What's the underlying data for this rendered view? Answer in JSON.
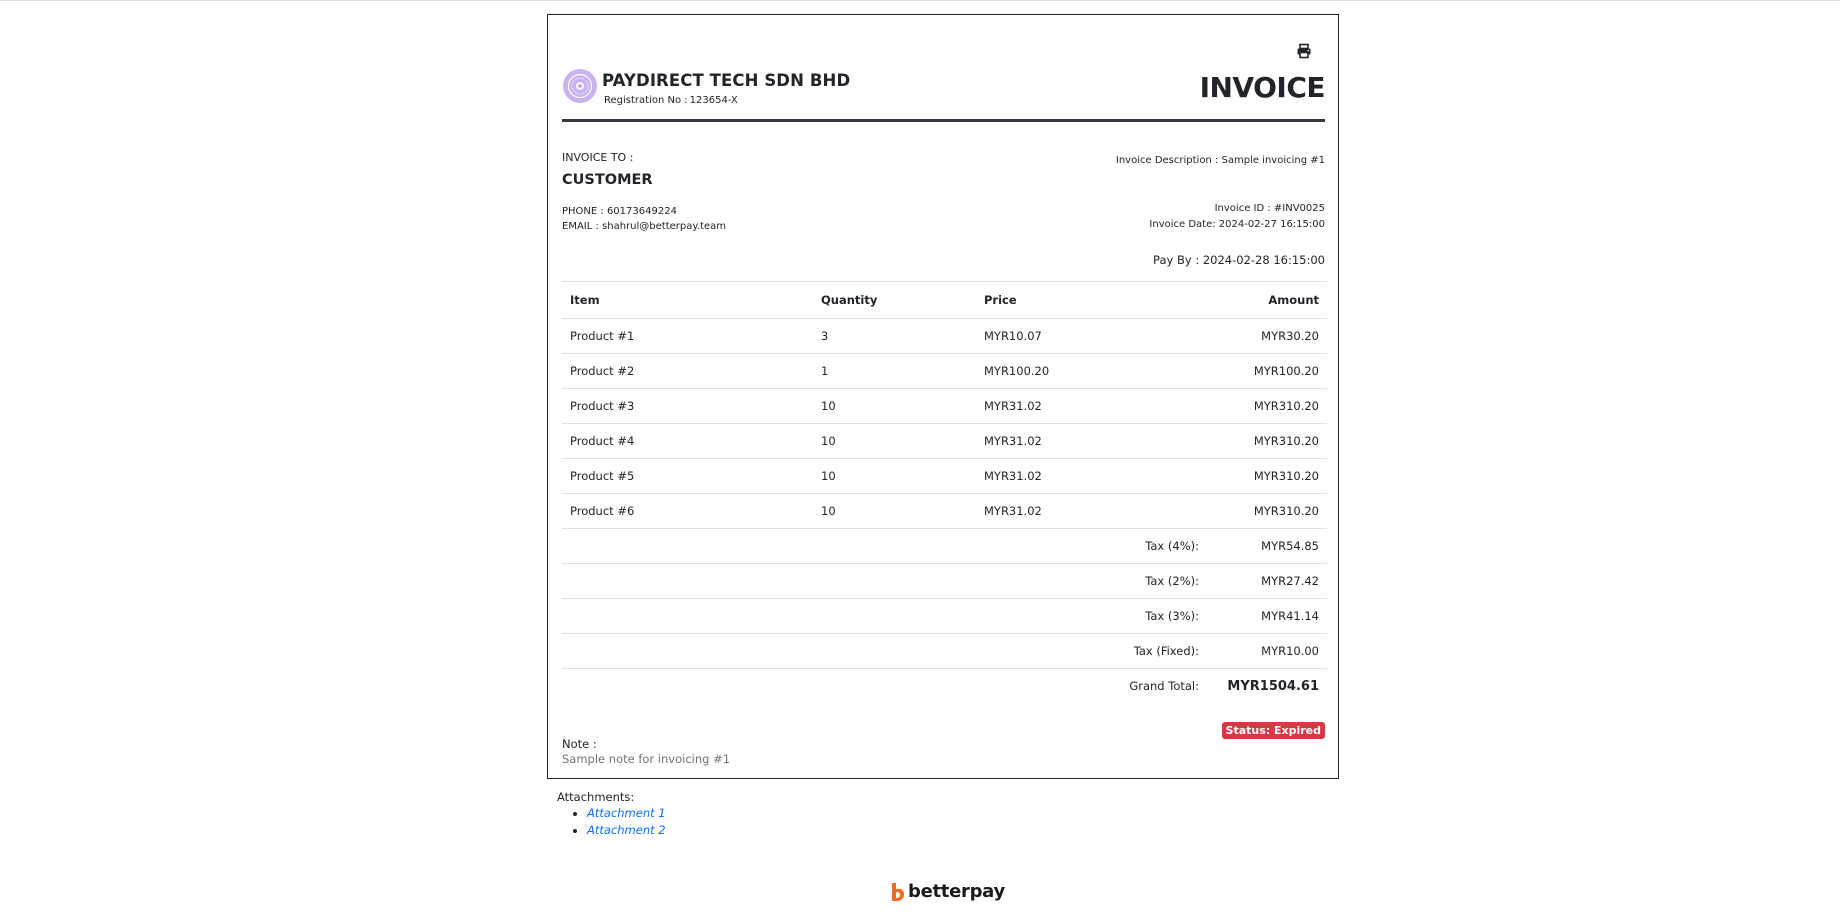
{
  "company": {
    "name": "PAYDIRECT TECH SDN BHD",
    "registration_label": "Registration No :",
    "registration_no": "123654-X"
  },
  "document_title": "INVOICE",
  "bill_to": {
    "label": "INVOICE TO :",
    "name": "CUSTOMER",
    "phone": "PHONE : 60173649224",
    "email": "EMAIL : shahrul@betterpay.team"
  },
  "meta": {
    "description": "Invoice Description : Sample invoicing #1",
    "invoice_id": "Invoice ID : #INV0025",
    "invoice_date": "Invoice Date: 2024-02-27 16:15:00",
    "pay_by": "Pay By : 2024-02-28 16:15:00"
  },
  "table": {
    "headers": {
      "item": "Item",
      "quantity": "Quantity",
      "price": "Price",
      "amount": "Amount"
    },
    "rows": [
      {
        "item": "Product #1",
        "quantity": "3",
        "price": "MYR10.07",
        "amount": "MYR30.20"
      },
      {
        "item": "Product #2",
        "quantity": "1",
        "price": "MYR100.20",
        "amount": "MYR100.20"
      },
      {
        "item": "Product #3",
        "quantity": "10",
        "price": "MYR31.02",
        "amount": "MYR310.20"
      },
      {
        "item": "Product #4",
        "quantity": "10",
        "price": "MYR31.02",
        "amount": "MYR310.20"
      },
      {
        "item": "Product #5",
        "quantity": "10",
        "price": "MYR31.02",
        "amount": "MYR310.20"
      },
      {
        "item": "Product #6",
        "quantity": "10",
        "price": "MYR31.02",
        "amount": "MYR310.20"
      }
    ],
    "taxes": [
      {
        "label": "Tax (4%):",
        "amount": "MYR54.85"
      },
      {
        "label": "Tax (2%):",
        "amount": "MYR27.42"
      },
      {
        "label": "Tax (3%):",
        "amount": "MYR41.14"
      },
      {
        "label": "Tax (Fixed):",
        "amount": "MYR10.00"
      }
    ],
    "grand_total_label": "Grand Total:",
    "grand_total": "MYR1504.61"
  },
  "status": "Status: Expired",
  "note": {
    "label": "Note :",
    "text": "Sample note for invoicing #1"
  },
  "attachments": {
    "label": "Attachments:",
    "items": [
      "Attachment 1",
      "Attachment 2"
    ]
  },
  "brand": "betterpay",
  "icons": {
    "print": "print-icon",
    "logo": "company-logo-icon",
    "brand": "betterpay-logo-icon"
  },
  "colors": {
    "status_badge": "#dc3545",
    "link": "#0d6efd",
    "logo_bg": "#c9b2ef",
    "brand_orange": "#f26b21"
  }
}
